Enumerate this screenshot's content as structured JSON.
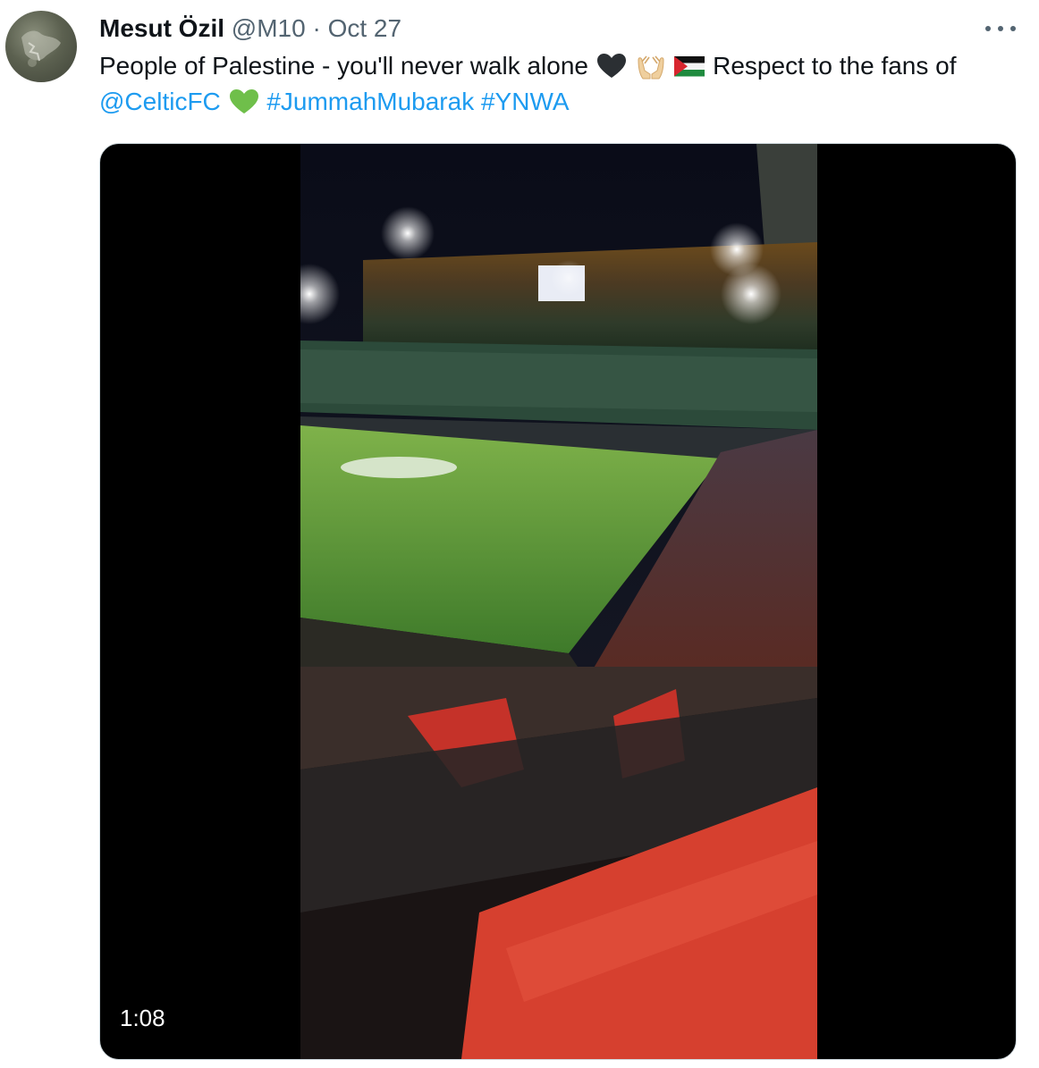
{
  "tweet": {
    "author_name": "Mesut Özil",
    "handle": "@M10",
    "separator": "·",
    "date": "Oct 27",
    "text_part1": "People of Palestine - you'll never walk alone",
    "text_part2": " Respect to the fans of ",
    "mention": "@CelticFC",
    "hashtag1": "#JummahMubarak",
    "hashtag2": "#YNWA",
    "emojis": [
      "black-heart-icon",
      "palms-up-together-icon",
      "palestine-flag-icon",
      "green-heart-icon"
    ]
  },
  "video": {
    "duration": "1:08"
  },
  "colors": {
    "text": "#0f1419",
    "secondary": "#536471",
    "link": "#1d9bf0",
    "border": "#cfd9de"
  }
}
